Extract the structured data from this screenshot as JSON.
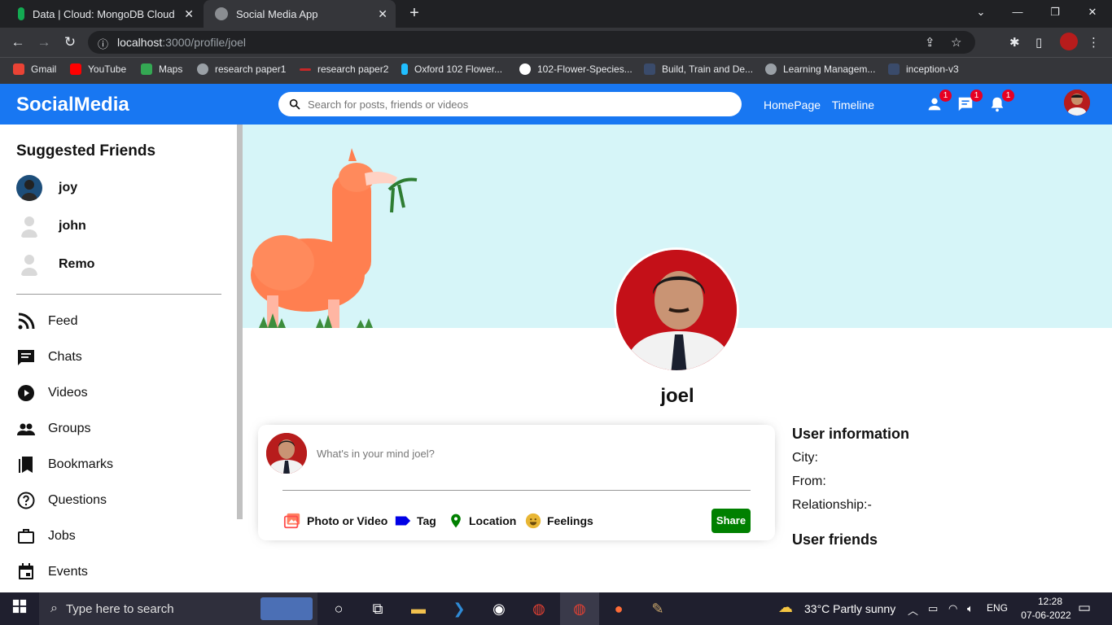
{
  "browser": {
    "tabs": [
      {
        "title": "Data | Cloud: MongoDB Cloud"
      },
      {
        "title": "Social Media App"
      }
    ],
    "url_host": "localhost",
    "url_path": ":3000/profile/joel"
  },
  "bookmarks": [
    {
      "label": "Gmail",
      "color": "#ea4335"
    },
    {
      "label": "YouTube",
      "color": "#ff0000"
    },
    {
      "label": "Maps",
      "color": "#34a853"
    },
    {
      "label": "research paper1",
      "color": "#9aa0a6"
    },
    {
      "label": "research paper2",
      "color": "#c62828"
    },
    {
      "label": "Oxford 102 Flower...",
      "color": "#20beff"
    },
    {
      "label": "102-Flower-Species...",
      "color": "#ffffff"
    },
    {
      "label": "Build, Train and De...",
      "color": "#3a4b6b"
    },
    {
      "label": "Learning Managem...",
      "color": "#9aa0a6"
    },
    {
      "label": "inception-v3",
      "color": "#3a4b6b"
    }
  ],
  "app": {
    "logo": "SocialMedia",
    "search_placeholder": "Search for posts, friends or videos",
    "nav": [
      "HomePage",
      "Timeline"
    ],
    "badges": {
      "friends": "1",
      "messages": "1",
      "notifications": "1"
    }
  },
  "sidebar": {
    "title": "Suggested Friends",
    "friends": [
      "joy",
      "john",
      "Remo"
    ],
    "items": [
      "Feed",
      "Chats",
      "Videos",
      "Groups",
      "Bookmarks",
      "Questions",
      "Jobs",
      "Events"
    ]
  },
  "profile": {
    "name": "joel",
    "share_placeholder": "What's in your mind joel?",
    "options": [
      "Photo or Video",
      "Tag",
      "Location",
      "Feelings"
    ],
    "share_button": "Share"
  },
  "rightbar": {
    "info_title": "User information",
    "city": "City:",
    "from": "From:",
    "relationship": "Relationship:-",
    "friends_title": "User friends"
  },
  "taskbar": {
    "search": "Type here to search",
    "weather": "33°C  Partly sunny",
    "lang": "ENG",
    "time": "12:28",
    "date": "07-06-2022"
  }
}
